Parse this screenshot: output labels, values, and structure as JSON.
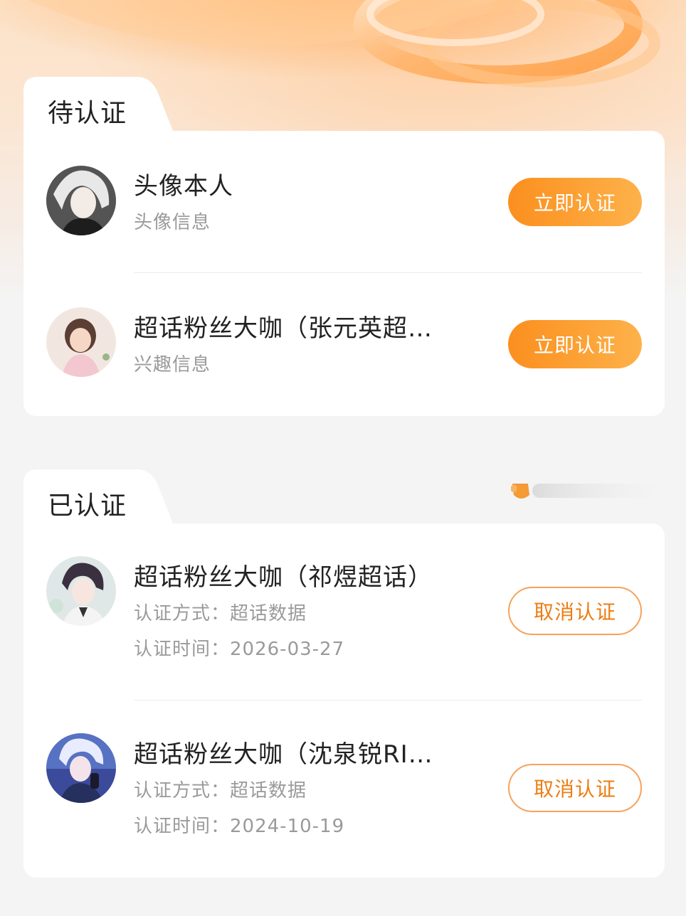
{
  "pending": {
    "section_title": "待认证",
    "items": [
      {
        "title": "头像本人",
        "subtitle": "头像信息",
        "action": "立即认证"
      },
      {
        "title": "超话粉丝大咖（张元英超…",
        "subtitle": "兴趣信息",
        "action": "立即认证"
      }
    ]
  },
  "verified": {
    "section_title": "已认证",
    "method_label": "认证方式：",
    "time_label": "认证时间：",
    "items": [
      {
        "title": "超话粉丝大咖（祁煜超话）",
        "method": "超话数据",
        "time": "2026-03-27",
        "action": "取消认证"
      },
      {
        "title": "超话粉丝大咖（沈泉锐RI…",
        "method": "超话数据",
        "time": "2024-10-19",
        "action": "取消认证"
      }
    ]
  },
  "colors": {
    "accent": "#fb8f1e",
    "accent_light": "#fdb24a",
    "outline": "#f6a25a",
    "text_primary": "#222222",
    "text_secondary": "#9a9a9a",
    "page_bg": "#f4f4f4"
  }
}
